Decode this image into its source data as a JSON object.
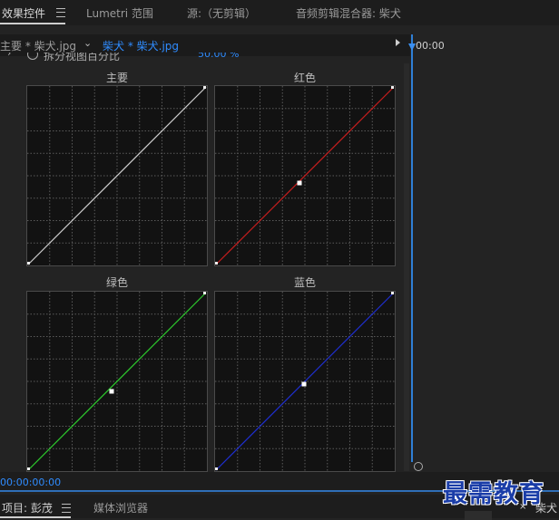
{
  "tabs": [
    {
      "label": "效果控件",
      "active": true
    },
    {
      "label": "Lumetri 范围",
      "active": false
    },
    {
      "label": "源:（无剪辑）",
      "active": false
    },
    {
      "label": "音频剪辑混合器: 柴犬",
      "active": false
    }
  ],
  "clip_row": {
    "master_label": "主要 * 柴犬.jpg",
    "chevron": "⌄",
    "active_clip": "柴犬 * 柴犬.jpg"
  },
  "split_view": {
    "label": "拆分视图百分比",
    "percent": "50.00 %"
  },
  "curves": [
    {
      "title": "主要",
      "color": "#cfcfcf",
      "has_midpoint": false
    },
    {
      "title": "红色",
      "color": "#c81e1e",
      "has_midpoint": true
    },
    {
      "title": "绿色",
      "color": "#2ecc2e",
      "has_midpoint": true
    },
    {
      "title": "蓝色",
      "color": "#1f2fd0",
      "has_midpoint": true
    }
  ],
  "timeline": {
    "time_label": "00:00"
  },
  "bottom": {
    "timecode": "00:00:00:00"
  },
  "lower_tabs": {
    "project": "项目: 彭茂",
    "media_browser": "媒体浏览器",
    "right_close": "×",
    "right_tab": "柴犬"
  },
  "watermark": "最需教育",
  "colors": {
    "accent": "#2f8cff",
    "panel_bg": "#232323",
    "curve_bg": "#121212"
  }
}
